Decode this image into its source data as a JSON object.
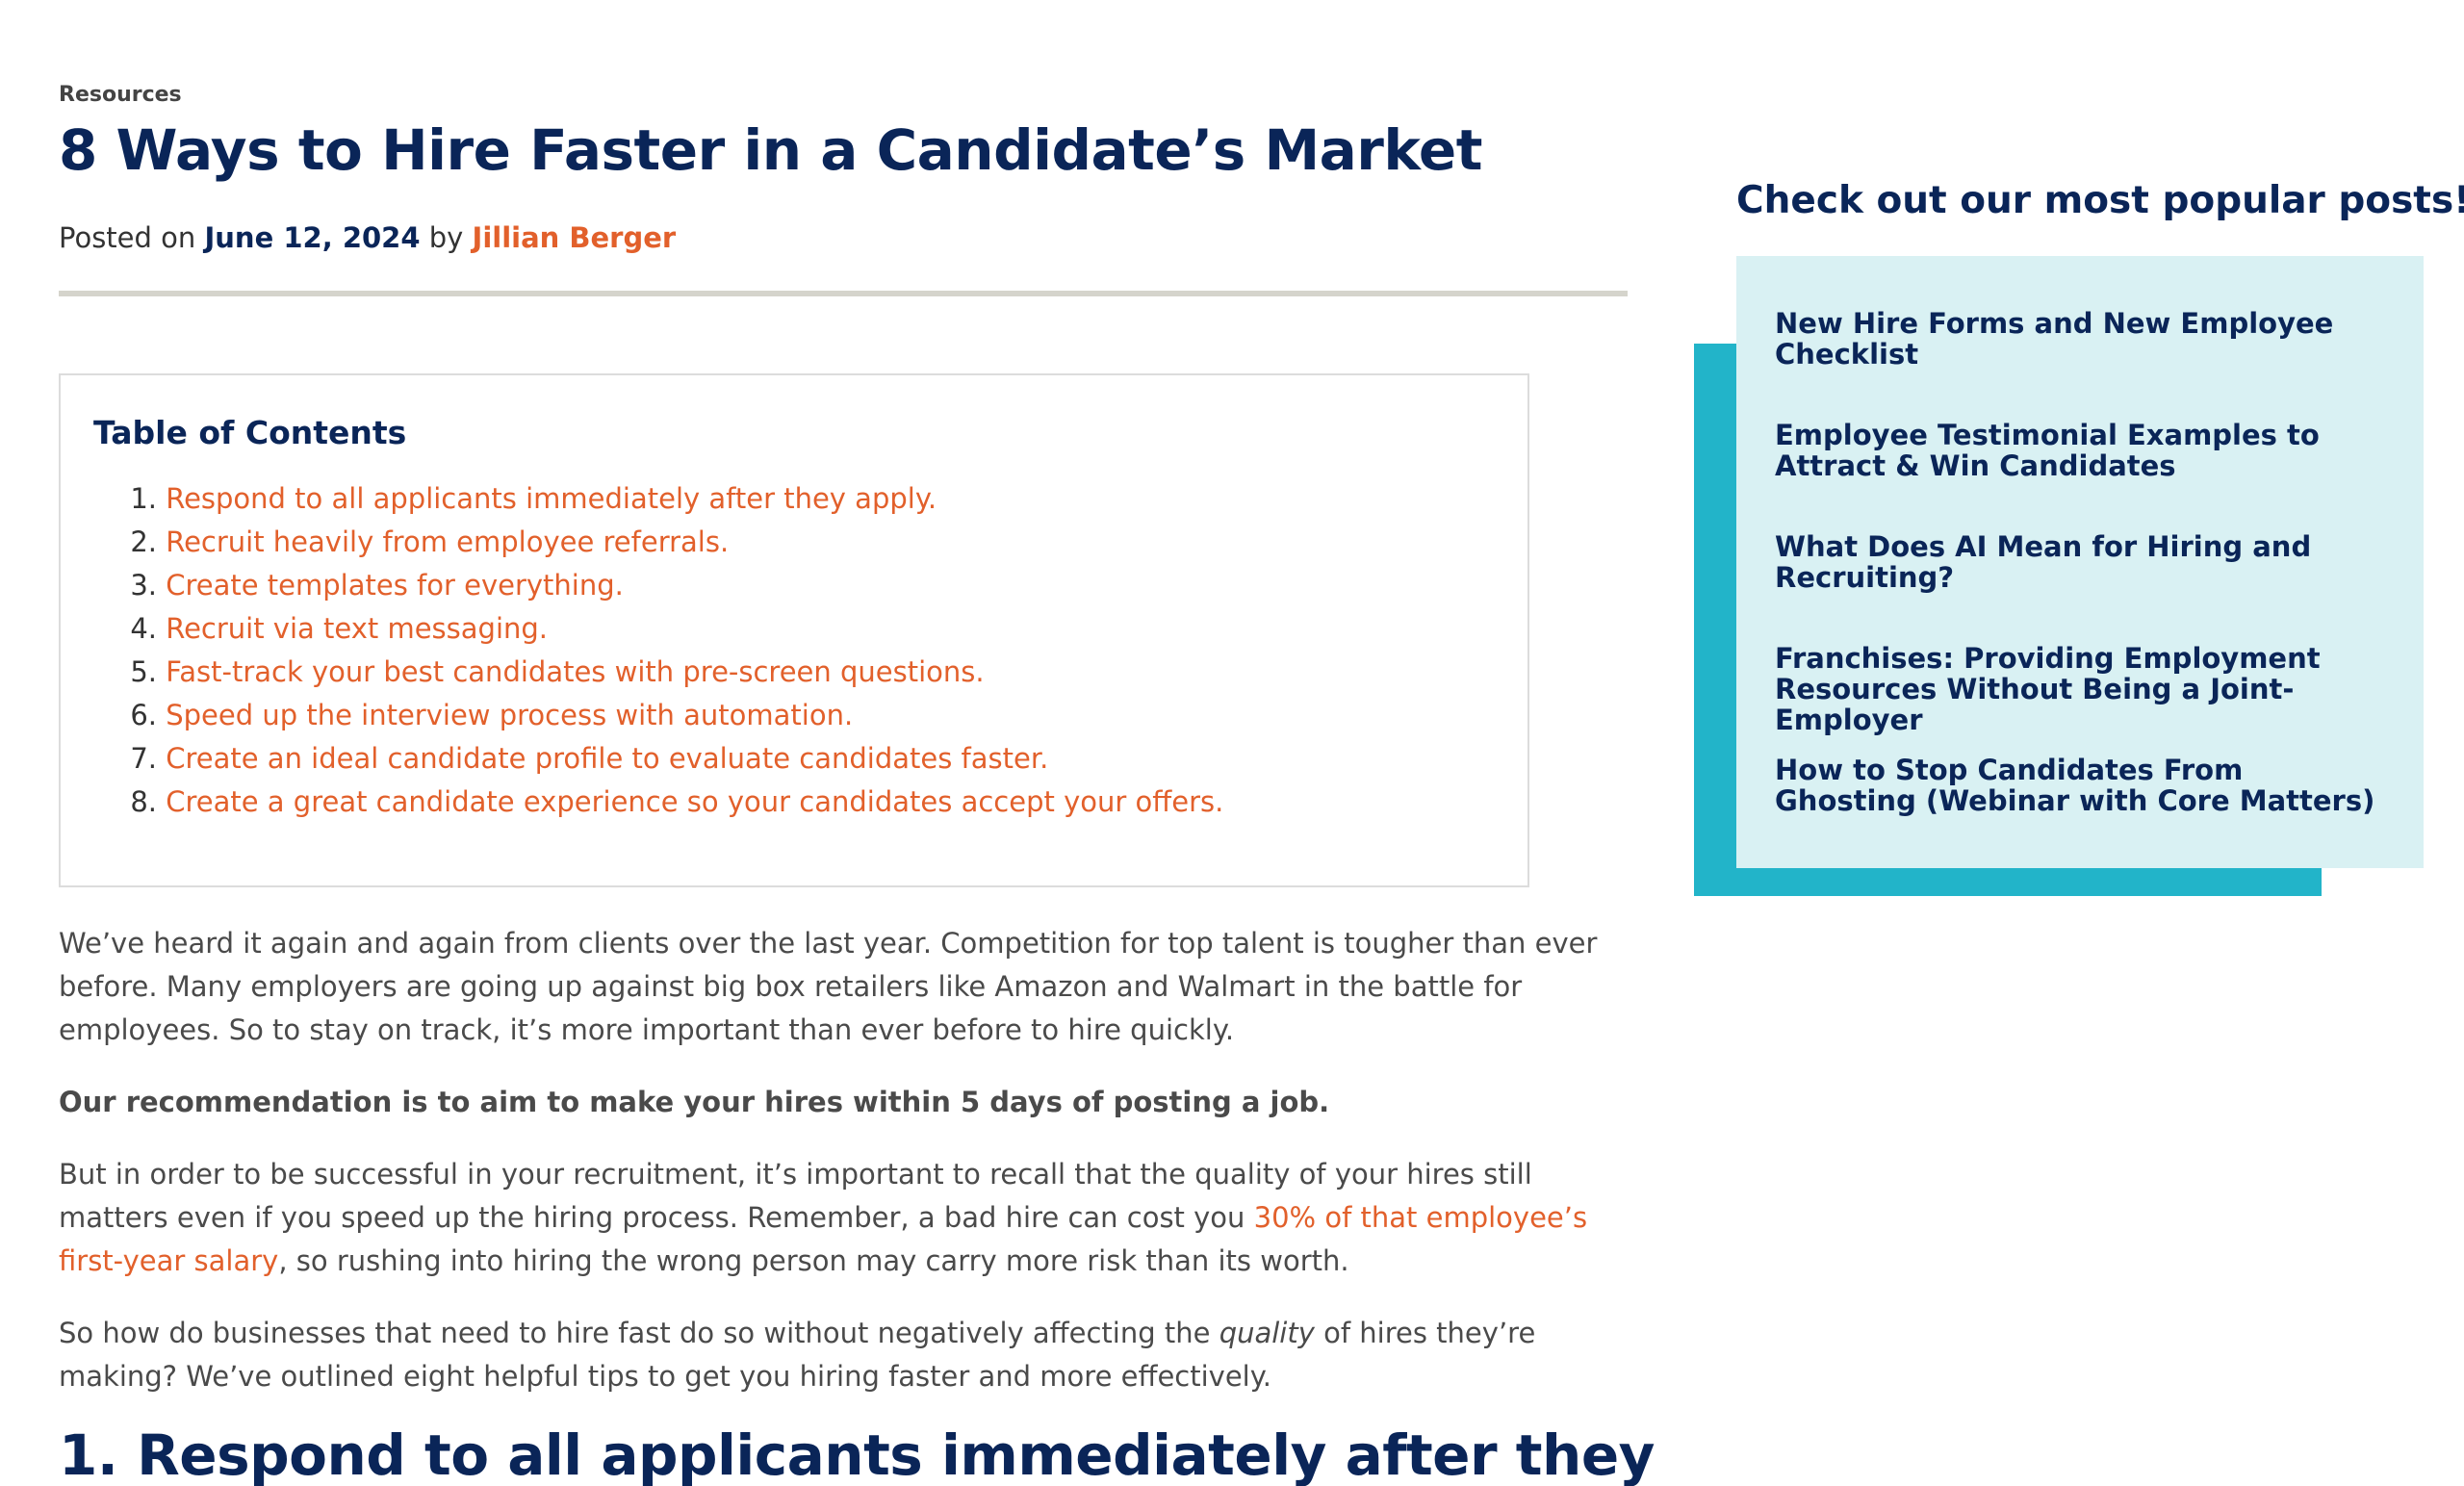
{
  "article": {
    "category": "Resources",
    "title": "8 Ways to Hire Faster in a Candidate’s Market",
    "meta": {
      "posted_on": "Posted on",
      "date": "June 12, 2024",
      "by": "by",
      "author": "Jillian Berger"
    },
    "toc": {
      "title": "Table of Contents",
      "items": [
        {
          "num": "1.",
          "label": "Respond to all applicants immediately after they apply."
        },
        {
          "num": "2.",
          "label": "Recruit heavily from employee referrals."
        },
        {
          "num": "3.",
          "label": "Create templates for everything."
        },
        {
          "num": "4.",
          "label": "Recruit via text messaging."
        },
        {
          "num": "5.",
          "label": "Fast-track your best candidates with pre-screen questions."
        },
        {
          "num": "6.",
          "label": "Speed up the interview process with automation."
        },
        {
          "num": "7.",
          "label": "Create an ideal candidate profile to evaluate candidates faster."
        },
        {
          "num": "8.",
          "label": "Create a great candidate experience so your candidates accept your offers."
        }
      ]
    },
    "paragraphs": {
      "p1": "We’ve heard it again and again from clients over the last year. Competition for top talent is tougher than ever before. Many employers are going up against big box retailers like Amazon and Walmart in the battle for employees. So to stay on track, it’s more important than ever before to hire quickly.",
      "p2": "Our recommendation is to aim to make your hires within 5 days of posting a job.",
      "p3_before": "But in order to be successful in your recruitment, it’s important to recall that the quality of your hires still matters even if you speed up the hiring process. Remember, a bad hire can cost you ",
      "p3_link": "30% of that employee’s first-year salary",
      "p3_after": ", so rushing into hiring the wrong person may carry more risk than its worth.",
      "p4_before": "So how do businesses that need to hire fast do so without negatively affecting the ",
      "p4_em": "quality",
      "p4_after": " of hires they’re making? We’ve outlined eight helpful tips to get you hiring faster and more effectively."
    },
    "section1_heading": "1. Respond to all applicants immediately after they"
  },
  "sidebar": {
    "heading": "Check out our most popular posts!",
    "posts": [
      {
        "title": "New Hire Forms and New Employee Checklist"
      },
      {
        "title": "Employee Testimonial Examples to Attract & Win Candidates"
      },
      {
        "title": "What Does AI Mean for Hiring and Recruiting?"
      },
      {
        "title": "Franchises: Providing Employment Resources Without Being a Joint-Employer"
      },
      {
        "title": "How to Stop Candidates From Ghosting (Webinar with Core Matters)"
      }
    ]
  },
  "colors": {
    "navy": "#0a2558",
    "orange": "#e2602b",
    "teal": "#22b4c9",
    "light_teal": "#d9f1f3",
    "rule": "#d5d4cc"
  }
}
